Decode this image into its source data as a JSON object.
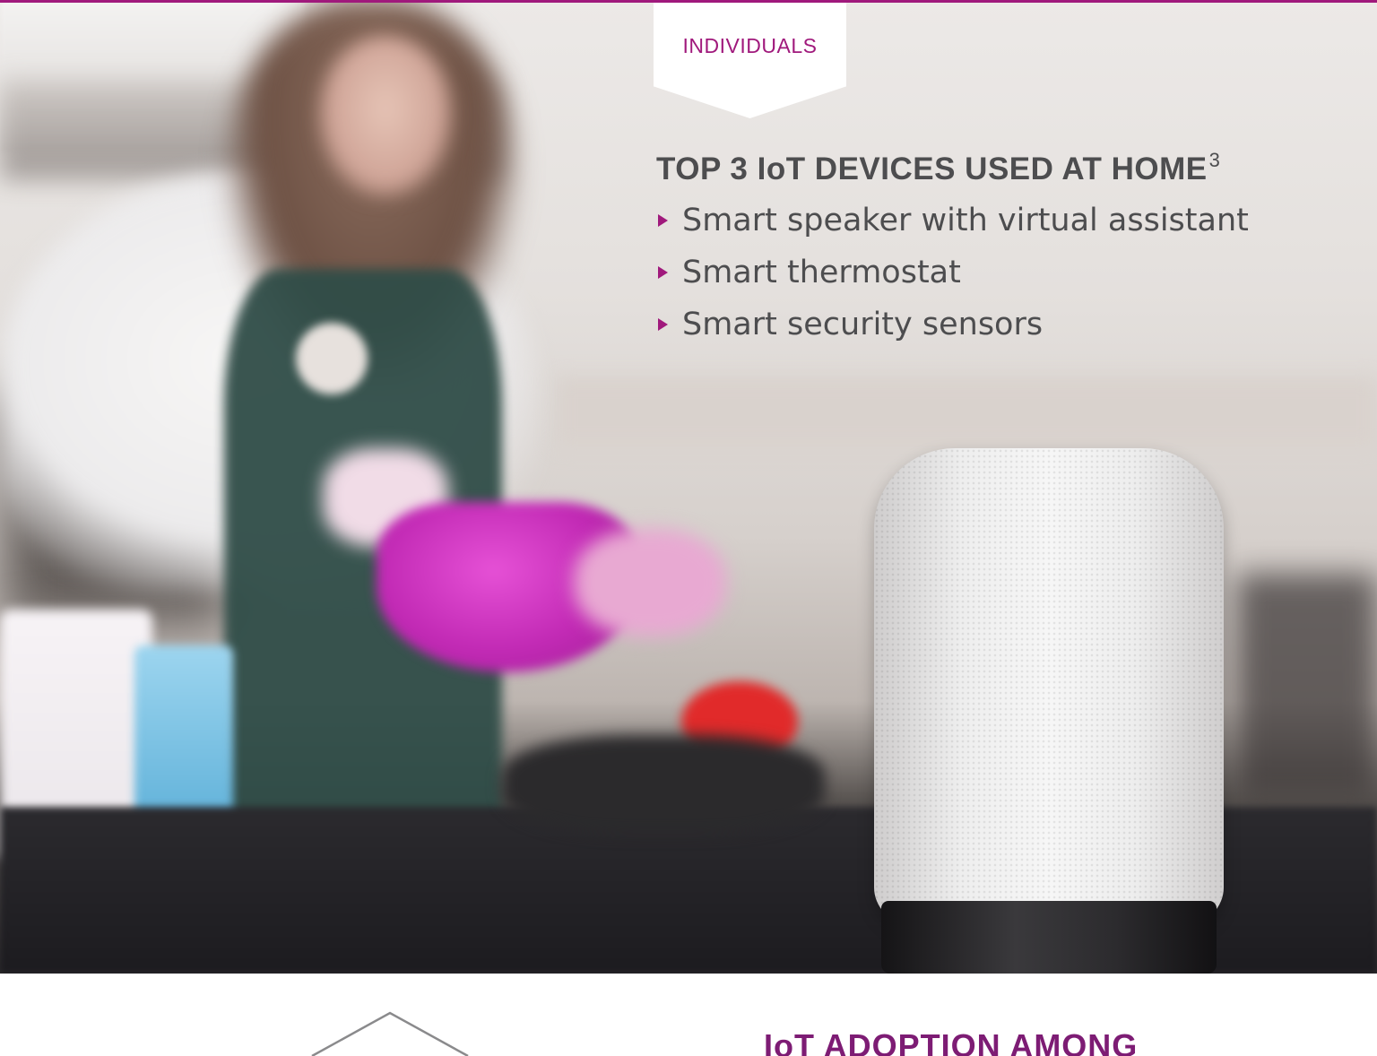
{
  "hero": {
    "tag_label": "INDIVIDUALS",
    "title": "TOP 3 IoT DEVICES USED AT HOME",
    "title_footnote": "3",
    "devices": [
      "Smart speaker with virtual assistant",
      "Smart thermostat",
      "Smart security sensors"
    ]
  },
  "lower": {
    "title": "IoT ADOPTION AMONG"
  },
  "colors": {
    "accent": "#a0197c",
    "heading_text": "#4d4d4f",
    "lower_title": "#7d1c74"
  }
}
